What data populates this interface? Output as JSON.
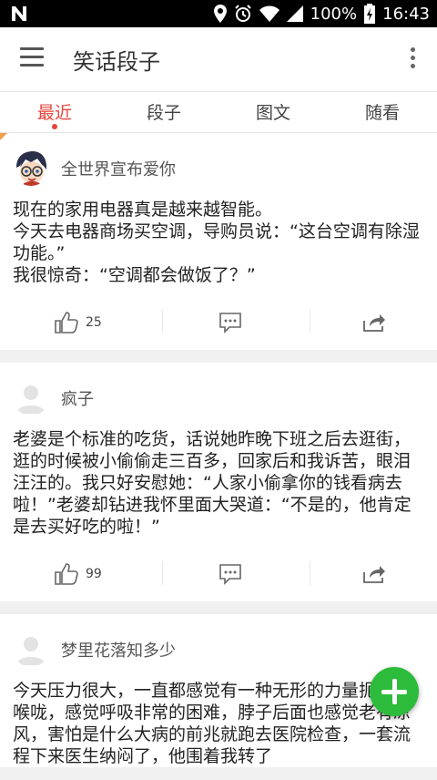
{
  "status_bar": {
    "battery": "100%",
    "time": "16:43"
  },
  "app_bar": {
    "title": "笑话段子"
  },
  "tabs": [
    {
      "label": "最近",
      "active": true
    },
    {
      "label": "段子",
      "active": false
    },
    {
      "label": "图文",
      "active": false
    },
    {
      "label": "随看",
      "active": false
    }
  ],
  "posts": [
    {
      "username": "全世界宣布爱你",
      "avatar": "cartoon-detective-avatar",
      "text": "现在的家用电器真是越来越智能。\n今天去电器商场买空调，导购员说：“这台空调有除湿功能。”\n我很惊奇：“空调都会做饭了？”",
      "likes": "25"
    },
    {
      "username": "疯子",
      "avatar": "default-avatar",
      "text": "老婆是个标准的吃货，话说她昨晚下班之后去逛街，逛的时候被小偷偷走三百多，回家后和我诉苦，眼泪汪汪的。我只好安慰她：“人家小偷拿你的钱看病去啦！”老婆却钻进我怀里面大哭道：“不是的，他肯定是去买好吃的啦！”",
      "likes": "99"
    },
    {
      "username": "梦里花落知多少",
      "avatar": "default-avatar",
      "text": "今天压力很大，一直都感觉有一种无形的力量扼住了喉咙，感觉呼吸非常的困难，脖子后面也感觉老有凉风，害怕是什么大病的前兆就跑去医院检查，一套流程下来医生纳闷了，他围着我转了",
      "likes": ""
    }
  ],
  "colors": {
    "accent": "#e8453c",
    "fab": "#2dbb3b",
    "corner_mark": "#f0a04b"
  }
}
